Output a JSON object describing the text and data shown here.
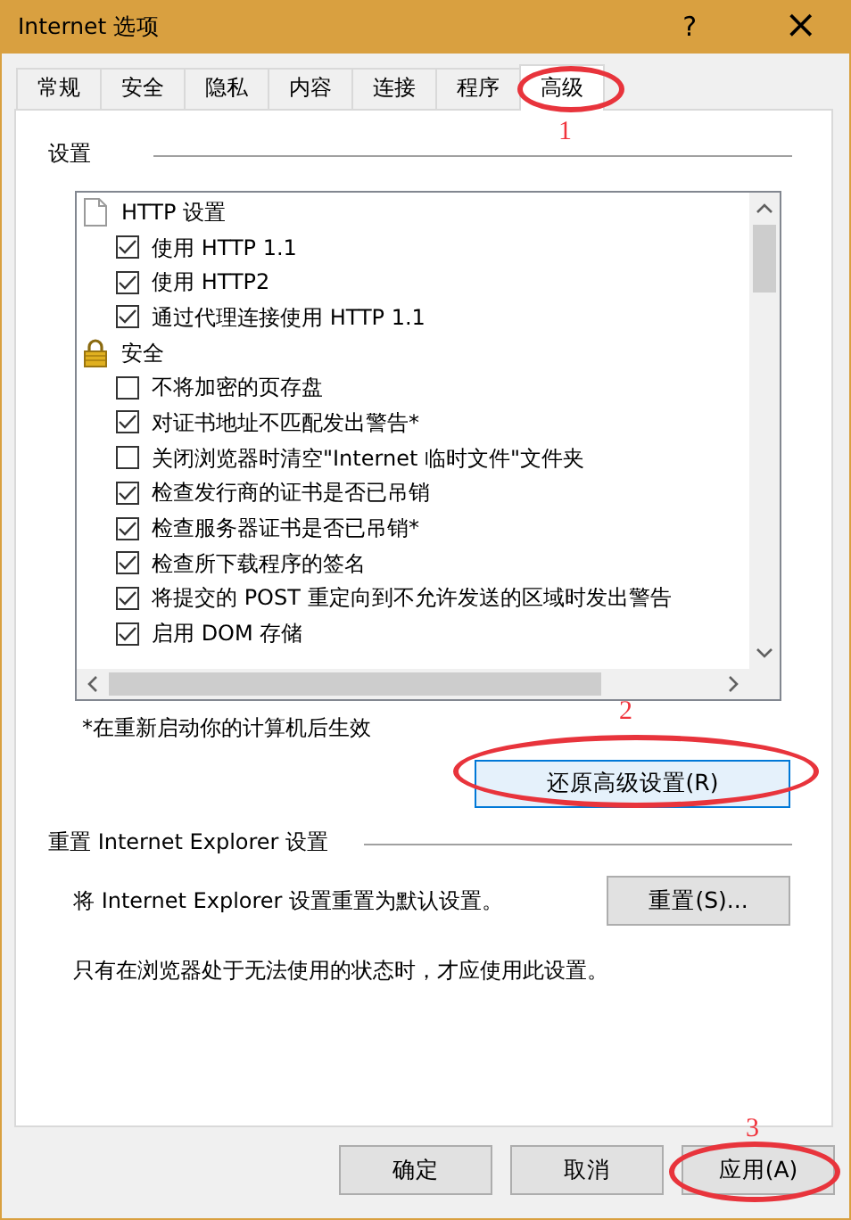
{
  "window": {
    "title": "Internet 选项",
    "help": "?",
    "close": "×"
  },
  "tabs": [
    {
      "label": "常规",
      "selected": false
    },
    {
      "label": "安全",
      "selected": false
    },
    {
      "label": "隐私",
      "selected": false
    },
    {
      "label": "内容",
      "selected": false
    },
    {
      "label": "连接",
      "selected": false
    },
    {
      "label": "程序",
      "selected": false
    },
    {
      "label": "高级",
      "selected": true
    }
  ],
  "settings": {
    "heading": "设置",
    "items": [
      {
        "kind": "document",
        "label": "HTTP 设置"
      },
      {
        "kind": "checkbox",
        "label": "使用 HTTP 1.1",
        "checked": true
      },
      {
        "kind": "checkbox",
        "label": "使用 HTTP2",
        "checked": true
      },
      {
        "kind": "checkbox",
        "label": "通过代理连接使用 HTTP 1.1",
        "checked": true
      },
      {
        "kind": "lock",
        "label": "安全"
      },
      {
        "kind": "checkbox",
        "label": "不将加密的页存盘",
        "checked": false
      },
      {
        "kind": "checkbox",
        "label": "对证书地址不匹配发出警告*",
        "checked": true
      },
      {
        "kind": "checkbox",
        "label": "关闭浏览器时清空\"Internet 临时文件\"文件夹",
        "checked": false
      },
      {
        "kind": "checkbox",
        "label": "检查发行商的证书是否已吊销",
        "checked": true
      },
      {
        "kind": "checkbox",
        "label": "检查服务器证书是否已吊销*",
        "checked": true
      },
      {
        "kind": "checkbox",
        "label": "检查所下载程序的签名",
        "checked": true
      },
      {
        "kind": "checkbox",
        "label": "将提交的 POST 重定向到不允许发送的区域时发出警告",
        "checked": true
      },
      {
        "kind": "checkbox",
        "label": "启用 DOM 存储",
        "checked": true
      }
    ],
    "note": "*在重新启动你的计算机后生效",
    "restore_button": {
      "label": "还原高级设置(R)"
    }
  },
  "reset": {
    "heading": "重置 Internet Explorer 设置",
    "description": "将 Internet Explorer 设置重置为默认设置。",
    "button": {
      "label": "重置(S)..."
    },
    "hint": "只有在浏览器处于无法使用的状态时，才应使用此设置。"
  },
  "buttons": [
    {
      "label": "确定"
    },
    {
      "label": "取消"
    },
    {
      "label": "应用(A)"
    }
  ],
  "annotations": [
    {
      "label": "1"
    },
    {
      "label": "2"
    },
    {
      "label": "3"
    }
  ]
}
